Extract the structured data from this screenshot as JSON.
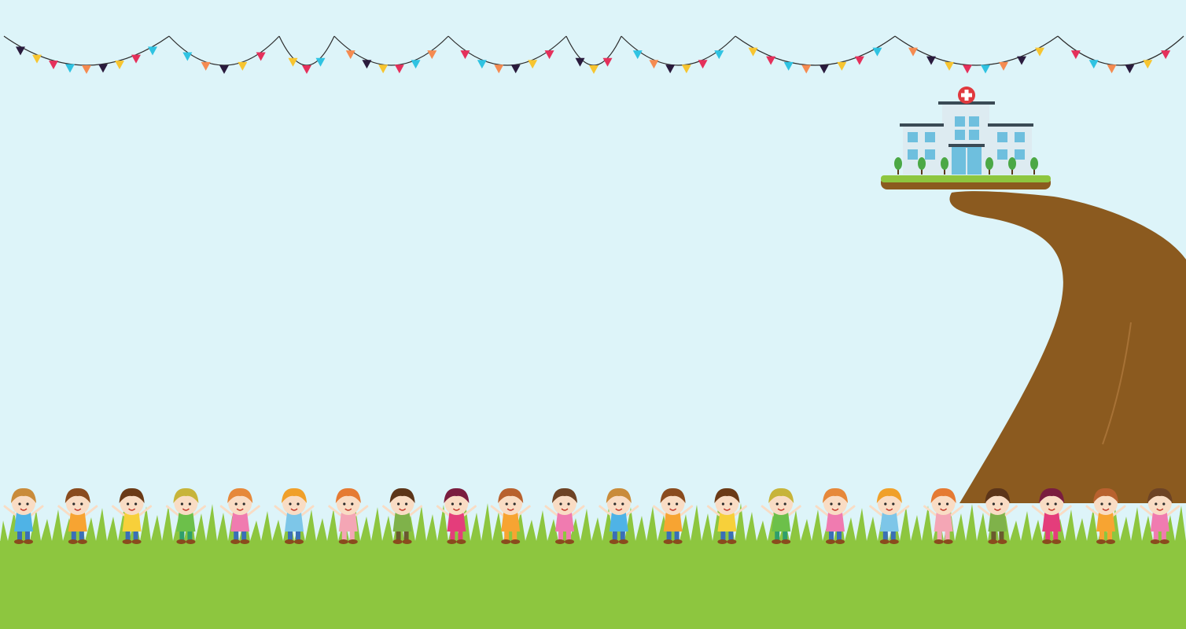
{
  "scene": {
    "description_icon_names": [
      "bunting-flags",
      "hospital-building",
      "cliff",
      "grass",
      "children-group"
    ],
    "colors": {
      "sky": "#DDF4F9",
      "grass": "#8DC63F",
      "grass_dark": "#7DB632",
      "path": "#8B5A1F",
      "hospital_wall": "#DDEBF1",
      "hospital_window": "#6EBFDE",
      "hospital_roof": "#3A4A55",
      "hospital_cross_bg": "#E0393E",
      "tree": "#4BA845"
    },
    "bunting_colors": [
      "#F58B51",
      "#2A1B3D",
      "#F7C530",
      "#E5305B",
      "#2FC3E2"
    ],
    "children_count": 22
  }
}
